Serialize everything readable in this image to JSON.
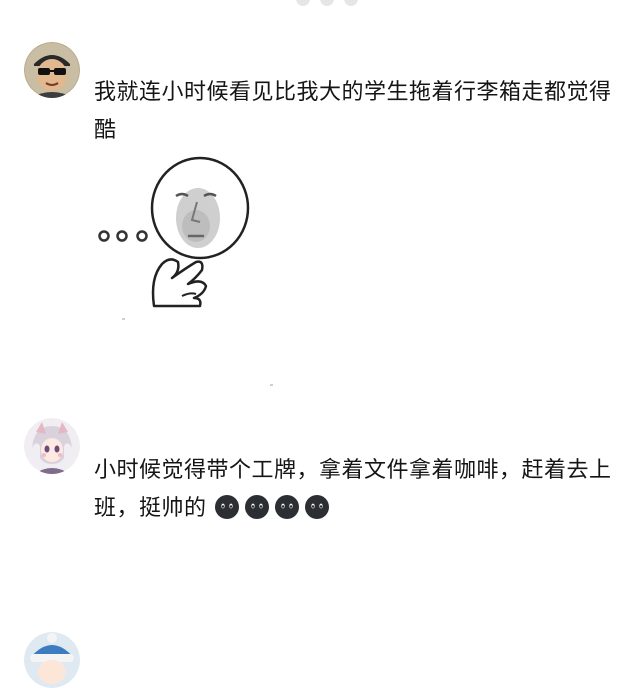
{
  "comments": [
    {
      "avatar_icon": "avatar-man-sunglasses-icon",
      "text": "我就连小时候看见比我大的学生拖着行李箱走都觉得酷",
      "sticker_icon": "thinking-face-meme-sticker"
    },
    {
      "avatar_icon": "avatar-anime-girl-icon",
      "text": "小时候觉得带个工牌，拿着文件拿着咖啡，赶着去上班，挺帅的",
      "emoji_icon": "dark-round-face-emoji-icon",
      "emoji_count": 4
    },
    {
      "avatar_icon": "avatar-snow-hat-icon"
    }
  ],
  "colors": {
    "text": "#151515",
    "background": "#ffffff",
    "emoji": "#2b2e33"
  }
}
